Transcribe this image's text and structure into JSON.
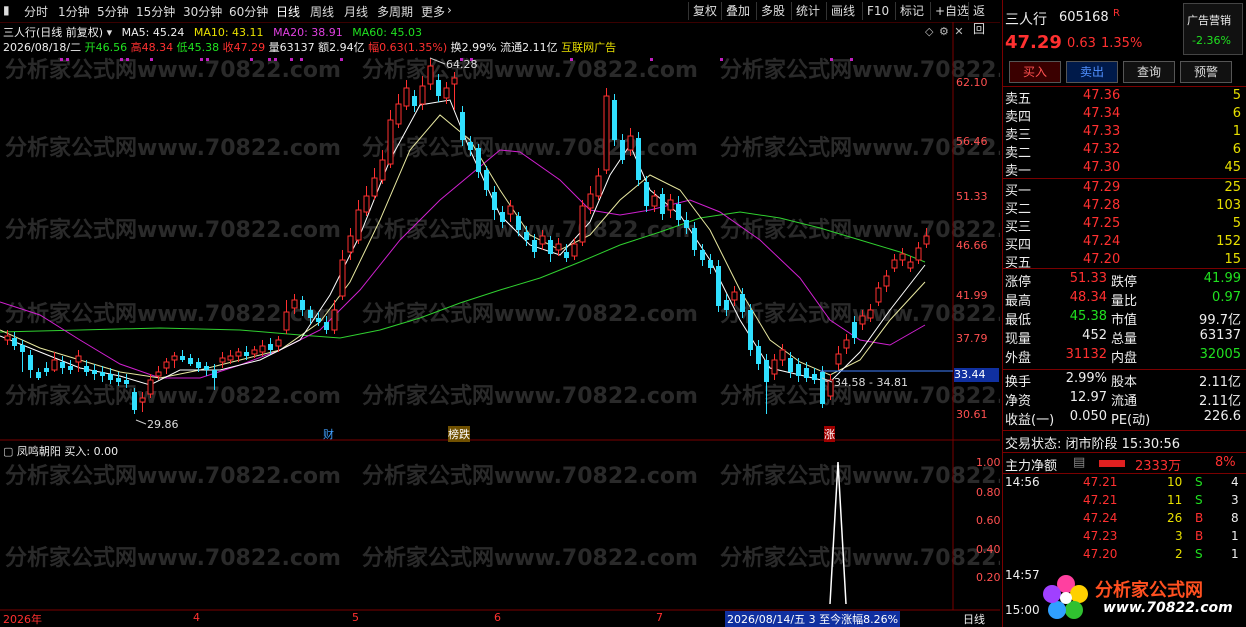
{
  "toolbar": {
    "periods": [
      "分时",
      "1分钟",
      "5分钟",
      "15分钟",
      "30分钟",
      "60分钟",
      "日线",
      "周线",
      "月线",
      "多周期",
      "更多"
    ],
    "right": [
      "复权",
      "叠加",
      "多股",
      "统计",
      "画线",
      "F10",
      "标记",
      "+自选",
      "返回"
    ]
  },
  "chart_header": {
    "title": "三人行(日线 前复权)",
    "ma5": "MA5: 45.24",
    "ma10": "MA10: 43.11",
    "ma20": "MA20: 38.91",
    "ma60": "MA60: 45.03",
    "date": "2026/08/18/二",
    "open": "开46.56",
    "high": "高48.34",
    "low": "低45.38",
    "close": "收47.29",
    "vol": "量63137",
    "amount": "额2.94亿",
    "amp": "幅0.63(1.35%)",
    "turnover": "换2.99%",
    "float": "流通2.11亿",
    "ad": "互联网广告"
  },
  "price_axis": [
    "62.10",
    "56.46",
    "51.33",
    "46.66",
    "41.99",
    "37.79",
    "33.44",
    "30.61"
  ],
  "annotations": {
    "high": "64.28",
    "low": "29.86",
    "range": "34.58 - 34.81",
    "tags": [
      "财",
      "榜跌",
      "涨"
    ]
  },
  "indicator": {
    "title": "凤鸣朝阳 买入: 0.00",
    "axis": [
      "1.00",
      "0.80",
      "0.60",
      "0.40",
      "0.20"
    ]
  },
  "time_axis": {
    "labels": [
      "2026年",
      "4",
      "5",
      "6",
      "7"
    ],
    "hover": "2026/08/14/五 3 至今涨幅8.26%",
    "period": "日线"
  },
  "watermark": "分析家公式网www.70822.com",
  "stock": {
    "name": "三人行",
    "code": "605168",
    "badge": "R",
    "ad_label": "广告营销",
    "ad_change": "-2.36%",
    "price": "47.29",
    "change": "0.63",
    "pct": "1.35%"
  },
  "buttons": [
    "买入",
    "卖出",
    "查询",
    "预警"
  ],
  "asks": [
    {
      "label": "卖五",
      "price": "47.36",
      "vol": "5"
    },
    {
      "label": "卖四",
      "price": "47.34",
      "vol": "6"
    },
    {
      "label": "卖三",
      "price": "47.33",
      "vol": "1"
    },
    {
      "label": "卖二",
      "price": "47.32",
      "vol": "6"
    },
    {
      "label": "卖一",
      "price": "47.30",
      "vol": "45"
    }
  ],
  "bids": [
    {
      "label": "买一",
      "price": "47.29",
      "vol": "25"
    },
    {
      "label": "买二",
      "price": "47.28",
      "vol": "103"
    },
    {
      "label": "买三",
      "price": "47.25",
      "vol": "5"
    },
    {
      "label": "买四",
      "price": "47.24",
      "vol": "152"
    },
    {
      "label": "买五",
      "price": "47.20",
      "vol": "15"
    }
  ],
  "stats": [
    {
      "l1": "涨停",
      "v1": "51.33",
      "l2": "跌停",
      "v2": "41.99"
    },
    {
      "l1": "最高",
      "v1": "48.34",
      "l2": "量比",
      "v2": "0.97"
    },
    {
      "l1": "最低",
      "v1": "45.38",
      "l2": "市值",
      "v2": "99.7亿"
    },
    {
      "l1": "现量",
      "v1": "452",
      "l2": "总量",
      "v2": "63137"
    },
    {
      "l1": "外盘",
      "v1": "31132",
      "l2": "内盘",
      "v2": "32005"
    }
  ],
  "stats2": [
    {
      "l1": "换手",
      "v1": "2.99%",
      "l2": "股本",
      "v2": "2.11亿"
    },
    {
      "l1": "净资",
      "v1": "12.97",
      "l2": "流通",
      "v2": "2.11亿"
    },
    {
      "l1": "收益(一)",
      "v1": "0.050",
      "l2": "PE(动)",
      "v2": "226.6"
    }
  ],
  "trade_state": "交易状态: 闭市阶段 15:30:56",
  "main_net": {
    "label": "主力净额",
    "value": "2333万",
    "pct": "8%"
  },
  "ticks": [
    {
      "time": "14:56",
      "price": "47.21",
      "vol": "10",
      "side": "S",
      "n": "4"
    },
    {
      "time": "",
      "price": "47.21",
      "vol": "11",
      "side": "S",
      "n": "3"
    },
    {
      "time": "",
      "price": "47.24",
      "vol": "26",
      "side": "B",
      "n": "8"
    },
    {
      "time": "",
      "price": "47.23",
      "vol": "3",
      "side": "B",
      "n": "1"
    },
    {
      "time": "",
      "price": "47.20",
      "vol": "2",
      "side": "S",
      "n": "1"
    }
  ],
  "tick_times": [
    "14:57",
    "15:00"
  ],
  "logo": {
    "text": "分析家公式网",
    "url": "www.70822.com"
  }
}
